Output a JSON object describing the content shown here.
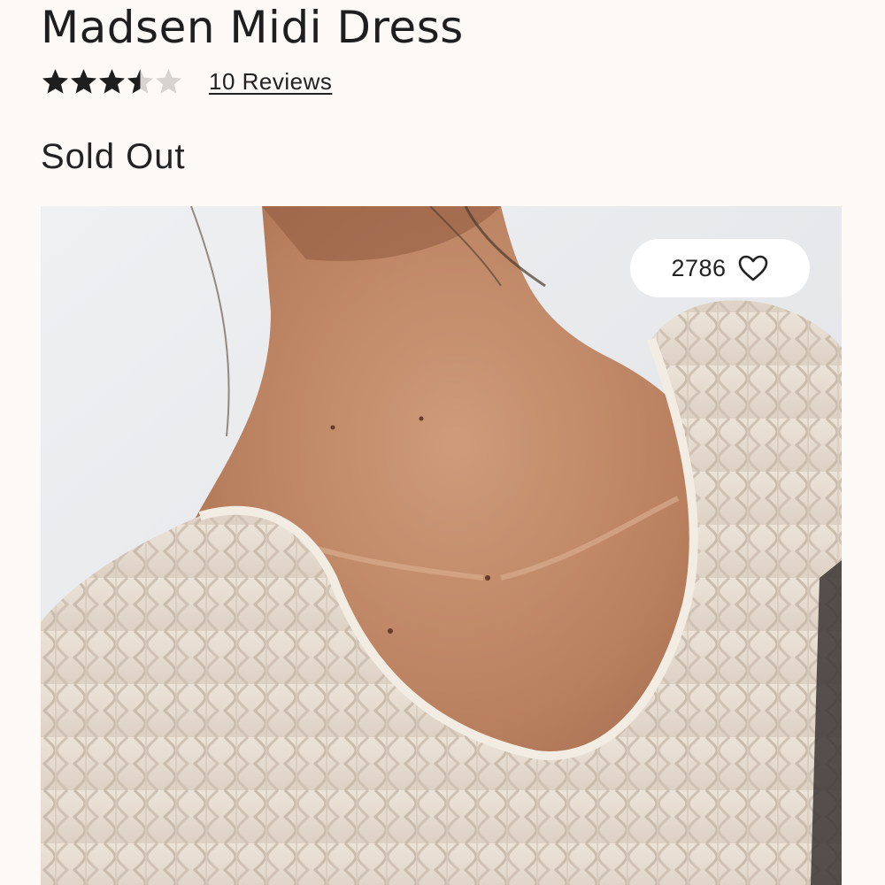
{
  "product": {
    "title": "Madsen Midi Dress",
    "rating": 3.5,
    "rating_max": 5,
    "reviews_label": "10 Reviews",
    "status": "Sold Out"
  },
  "image": {
    "icon": "photo-model-cable-knit-sweater",
    "like_count": "2786",
    "like_icon": "heart-outline-icon"
  },
  "colors": {
    "background": "#fcf9f7",
    "star_filled": "#1e1e1e",
    "star_empty": "#d6d3d1",
    "pill": "#ffffff"
  }
}
